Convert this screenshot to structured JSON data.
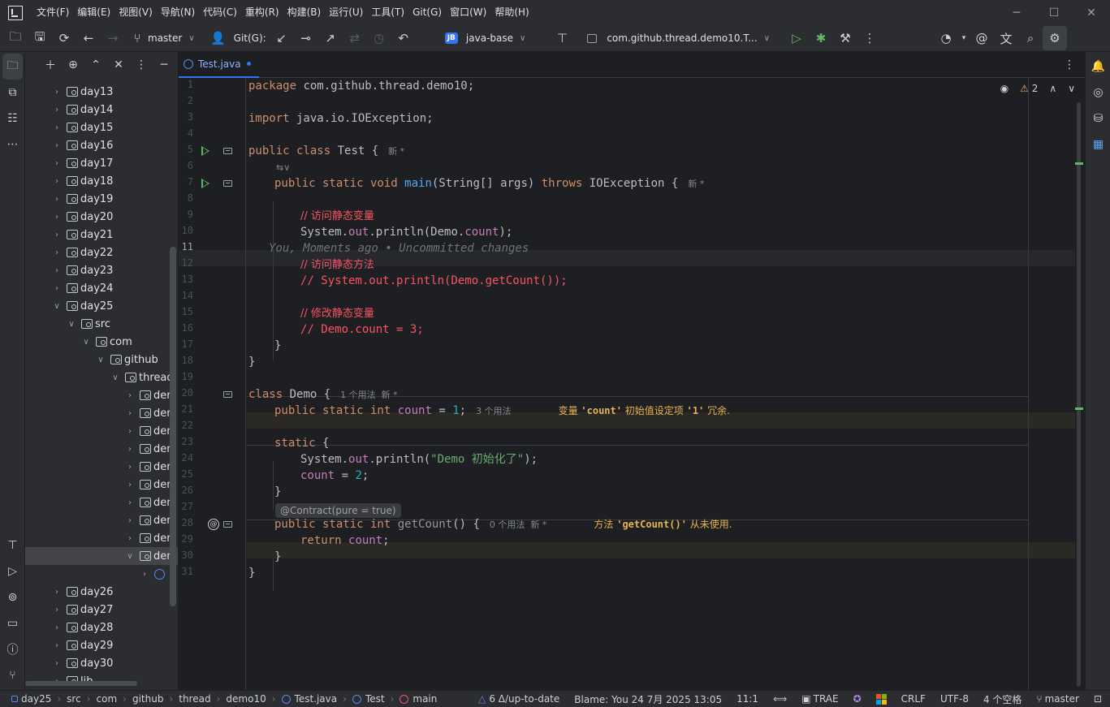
{
  "menubar": {
    "items": [
      "文件(F)",
      "编辑(E)",
      "视图(V)",
      "导航(N)",
      "代码(C)",
      "重构(R)",
      "构建(B)",
      "运行(U)",
      "工具(T)",
      "Git(G)",
      "窗口(W)",
      "帮助(H)"
    ]
  },
  "toolbar": {
    "branch": "master",
    "git_label": "Git(G):",
    "project_badge": "JB",
    "project_name": "java-base",
    "run_config": "com.github.thread.demo10.T..."
  },
  "project_tree": {
    "rows": [
      {
        "label": "day13",
        "depth": 0,
        "expanded": false
      },
      {
        "label": "day14",
        "depth": 0,
        "expanded": false
      },
      {
        "label": "day15",
        "depth": 0,
        "expanded": false
      },
      {
        "label": "day16",
        "depth": 0,
        "expanded": false
      },
      {
        "label": "day17",
        "depth": 0,
        "expanded": false
      },
      {
        "label": "day18",
        "depth": 0,
        "expanded": false
      },
      {
        "label": "day19",
        "depth": 0,
        "expanded": false
      },
      {
        "label": "day20",
        "depth": 0,
        "expanded": false
      },
      {
        "label": "day21",
        "depth": 0,
        "expanded": false
      },
      {
        "label": "day22",
        "depth": 0,
        "expanded": false
      },
      {
        "label": "day23",
        "depth": 0,
        "expanded": false
      },
      {
        "label": "day24",
        "depth": 0,
        "expanded": false
      },
      {
        "label": "day25",
        "depth": 0,
        "expanded": true
      },
      {
        "label": "src",
        "depth": 1,
        "expanded": true
      },
      {
        "label": "com",
        "depth": 2,
        "expanded": true
      },
      {
        "label": "github",
        "depth": 3,
        "expanded": true
      },
      {
        "label": "thread",
        "depth": 4,
        "expanded": true
      },
      {
        "label": "dem",
        "depth": 5,
        "expanded": false
      },
      {
        "label": "dem",
        "depth": 5,
        "expanded": false
      },
      {
        "label": "dem",
        "depth": 5,
        "expanded": false
      },
      {
        "label": "dem",
        "depth": 5,
        "expanded": false
      },
      {
        "label": "dem",
        "depth": 5,
        "expanded": false
      },
      {
        "label": "dem",
        "depth": 5,
        "expanded": false
      },
      {
        "label": "dem",
        "depth": 5,
        "expanded": false
      },
      {
        "label": "dem",
        "depth": 5,
        "expanded": false
      },
      {
        "label": "dem",
        "depth": 5,
        "expanded": false
      },
      {
        "label": "dem",
        "depth": 5,
        "expanded": true,
        "selected": true
      },
      {
        "label": "",
        "depth": 6,
        "expanded": false,
        "java": true
      },
      {
        "label": "day26",
        "depth": 0,
        "expanded": false
      },
      {
        "label": "day27",
        "depth": 0,
        "expanded": false
      },
      {
        "label": "day28",
        "depth": 0,
        "expanded": false
      },
      {
        "label": "day29",
        "depth": 0,
        "expanded": false
      },
      {
        "label": "day30",
        "depth": 0,
        "expanded": false
      },
      {
        "label": "lib",
        "depth": 0,
        "expanded": false
      }
    ]
  },
  "editor": {
    "tab_label": "Test.java",
    "warning_count": "2",
    "line_numbers": [
      "1",
      "2",
      "3",
      "4",
      "5",
      "6",
      "7",
      "8",
      "9",
      "10",
      "11",
      "12",
      "13",
      "14",
      "15",
      "16",
      "17",
      "18",
      "19",
      "20",
      "21",
      "22",
      "23",
      "24",
      "25",
      "26",
      "27",
      "28",
      "29",
      "30",
      "31"
    ],
    "current_line": "11",
    "blame_text": "You, Moments ago • Uncommitted changes",
    "annotation_chip": "@Contract(pure = true)",
    "code": {
      "l1_kw": "package",
      "l1_rest": " com.github.thread.demo10;",
      "l3_kw": "import",
      "l3_rest": " java.io.IOException;",
      "l5_kw": "public class",
      "l5_rest": " Test {",
      "l5_hint": "新 *",
      "l6_hint": "⇆∨",
      "l7_kw": "public static void",
      "l7_fn": "main",
      "l7_rest": "(String[] args) ",
      "l7_kw2": "throws",
      "l7_rest2": " IOException {",
      "l7_hint": "新 *",
      "l9_cm": "// 访问静态变量",
      "l10_a": "System.",
      "l10_f": "out",
      "l10_b": ".println(Demo.",
      "l10_f2": "count",
      "l10_c": ");",
      "l12_cm": "// 访问静态方法",
      "l13_cm": "// System.out.println(Demo.getCount());",
      "l15_cm": "// 修改静态变量",
      "l16_cm": "// Demo.count = 3;",
      "l17": "}",
      "l18": "}",
      "l20_kw": "class",
      "l20_rest": " Demo {",
      "l20_hint": "1 个用法  新 *",
      "l21_kw": "public static int",
      "l21_f": "count",
      "l21_rest": " = ",
      "l21_num": "1",
      "l21_end": ";",
      "l21_hint": "3 个用法",
      "l21_warn_a": "变量 ",
      "l21_warn_b": "'count'",
      "l21_warn_c": " 初始值设定项 ",
      "l21_warn_d": "'1'",
      "l21_warn_e": " 冗余.",
      "l23_kw": "static",
      "l23_rest": " {",
      "l24_a": "System.",
      "l24_f": "out",
      "l24_b": ".println(",
      "l24_str": "\"Demo 初始化了\"",
      "l24_c": ");",
      "l25_f": "count",
      "l25_rest": " = ",
      "l25_num": "2",
      "l25_end": ";",
      "l26": "}",
      "l28_kw": "public static int",
      "l28_fn": "getCount",
      "l28_rest": "() {",
      "l28_hint": "0 个用法  新 *",
      "l28_warn_a": "方法 ",
      "l28_warn_b": "'getCount()'",
      "l28_warn_c": " 从未使用.",
      "l29_kw": "return",
      "l29_f": "count",
      "l29_end": ";",
      "l30": "}",
      "l31": "}"
    }
  },
  "statusbar": {
    "breadcrumbs": [
      "day25",
      "src",
      "com",
      "github",
      "thread",
      "demo10",
      "Test.java",
      "Test",
      "main"
    ],
    "vcs_status": "6 Δ/up-to-date",
    "blame": "Blame: You 24 7月 2025 13:05",
    "position": "11:1",
    "trae": "TRAE",
    "line_sep": "CRLF",
    "encoding": "UTF-8",
    "indent": "4 个空格",
    "branch": "master"
  },
  "colors": {
    "accent": "#3574f0",
    "keyword": "#cf8e6d",
    "comment": "#f75464",
    "string": "#6aab73",
    "number": "#2aacb8",
    "field": "#c77dbb",
    "function": "#56a8f5",
    "warning": "#e6b450",
    "run_green": "#5fb865"
  }
}
